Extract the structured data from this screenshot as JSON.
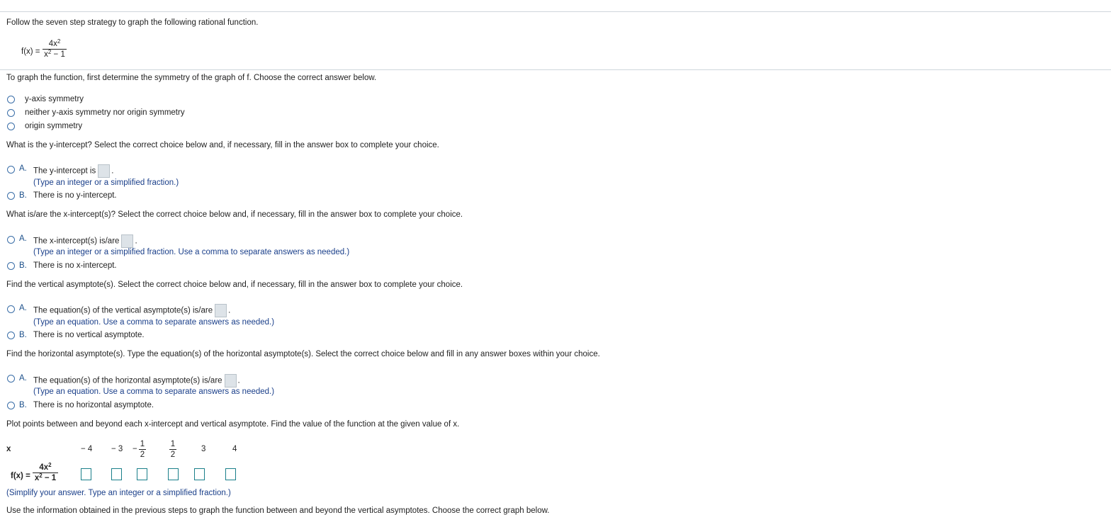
{
  "intro": "Follow the seven step strategy to graph the following rational function.",
  "function": {
    "lhs": "f(x) =",
    "num_base": "4x",
    "den_base": "x",
    "exp": "2",
    "den_tail": " − 1"
  },
  "symmetry": {
    "question": "To graph the function, first determine the symmetry of the graph of f. Choose the correct answer below.",
    "options": [
      "y-axis symmetry",
      "neither y-axis symmetry nor origin symmetry",
      "origin symmetry"
    ]
  },
  "y_intercept": {
    "question": "What is the y-intercept? Select the correct choice below and, if necessary, fill in the answer box to complete your choice.",
    "a_letter": "A.",
    "a_text": "The y-intercept is",
    "a_end": ".",
    "a_hint": "(Type an integer or a simplified fraction.)",
    "b_letter": "B.",
    "b_text": "There is no y-intercept."
  },
  "x_intercept": {
    "question": "What is/are the x-intercept(s)? Select the correct choice below and, if necessary, fill in the answer box to complete your choice.",
    "a_letter": "A.",
    "a_text": "The x-intercept(s) is/are",
    "a_end": ".",
    "a_hint": "(Type an integer or a simplified fraction. Use a comma to separate answers as needed.)",
    "b_letter": "B.",
    "b_text": "There is no x-intercept."
  },
  "vertical": {
    "question": "Find the vertical asymptote(s). Select the correct choice below and, if necessary, fill in the answer box to complete your choice.",
    "a_letter": "A.",
    "a_text": "The equation(s) of the vertical asymptote(s) is/are",
    "a_end": ".",
    "a_hint": "(Type an equation. Use a comma to separate answers as needed.)",
    "b_letter": "B.",
    "b_text": "There is no vertical asymptote."
  },
  "horizontal": {
    "question": "Find the horizontal asymptote(s). Type the equation(s) of the horizontal asymptote(s). Select the correct choice below and fill in any answer boxes within your choice.",
    "a_letter": "A.",
    "a_text": "The equation(s) of the horizontal asymptote(s) is/are",
    "a_end": ".",
    "a_hint": "(Type an equation. Use a comma to separate answers as needed.)",
    "b_letter": "B.",
    "b_text": "There is no horizontal asymptote."
  },
  "plot": {
    "question": "Plot points between and beyond each x-intercept and vertical asymptote. Find the value of the function at the given value of x.",
    "x_label": "x",
    "x_values": [
      "− 4",
      "− 3"
    ],
    "neg_sign": "−",
    "frac_num": "1",
    "frac_den": "2",
    "x_values_end": [
      "3",
      "4"
    ],
    "row_label": "f(x) =",
    "hint": "(Simplify your answer. Type an integer or a simplified fraction.)"
  },
  "final": "Use the information obtained in the previous steps to graph the function between and beyond the vertical asymptotes. Choose the correct graph below."
}
